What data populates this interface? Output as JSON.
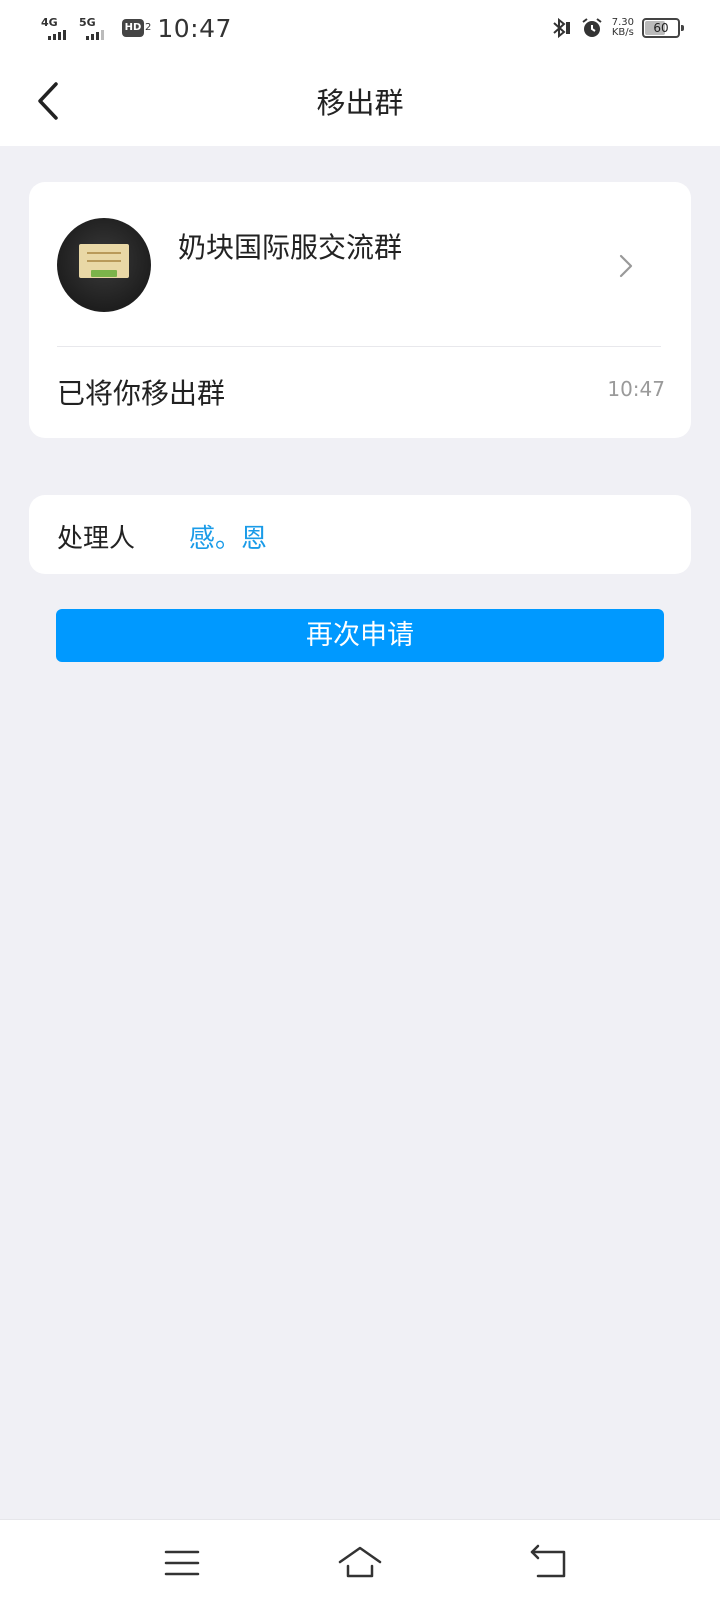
{
  "status_bar": {
    "network_1": "4G",
    "network_2": "5G",
    "hd_badge": "HD",
    "hd_sub": "2",
    "time": "10:47",
    "speed_value": "7.30",
    "speed_unit": "KB/s",
    "battery": "60",
    "battery_level": 0.6
  },
  "header": {
    "title": "移出群"
  },
  "group_card": {
    "group_name": "奶块国际服交流群",
    "status_text": "已将你移出群",
    "status_time": "10:47"
  },
  "handler_card": {
    "label": "处理人",
    "name": "感。恩"
  },
  "actions": {
    "reapply_label": "再次申请"
  },
  "colors": {
    "accent": "#0099ff",
    "link": "#1a9be8",
    "background": "#f0f0f5"
  },
  "icons": {
    "back": "back-arrow-icon",
    "chevron": "chevron-right-icon",
    "menu": "menu-icon",
    "home": "home-icon",
    "sys_back": "return-icon"
  }
}
